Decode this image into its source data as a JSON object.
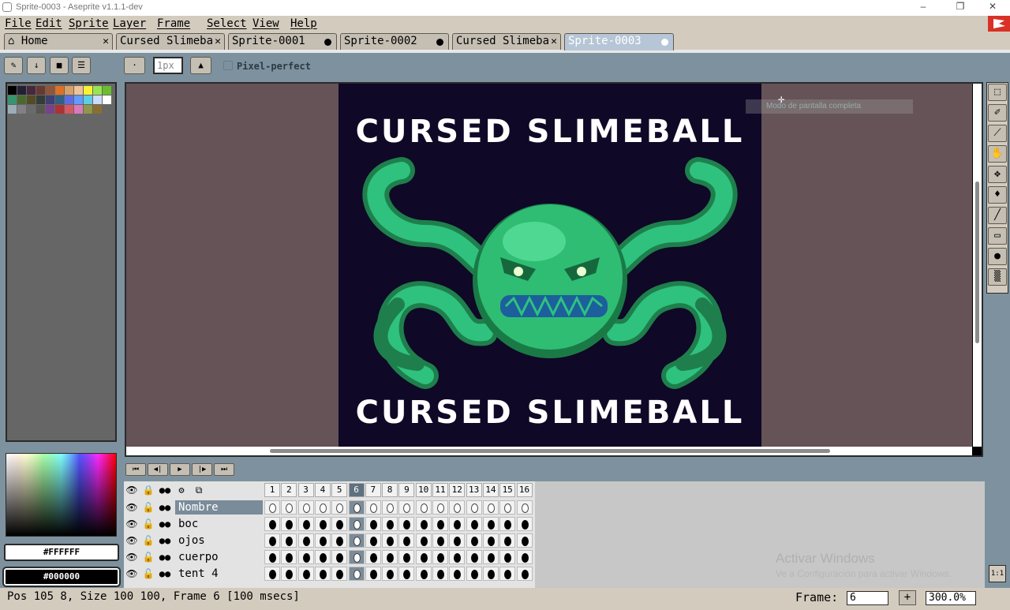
{
  "window": {
    "title": "Sprite-0003 - Aseprite v1.1.1-dev",
    "minimize": "‒",
    "maximize": "❐",
    "close": "✕"
  },
  "menu": [
    "File",
    "Edit",
    "Sprite",
    "Layer",
    "Frame",
    "Select",
    "View",
    "Help"
  ],
  "tabs": [
    {
      "label": "Home",
      "mark": "✕"
    },
    {
      "label": "Cursed Slimeba",
      "mark": "✕"
    },
    {
      "label": "Sprite-0001",
      "mark": ""
    },
    {
      "label": "Sprite-0002",
      "mark": ""
    },
    {
      "label": "Cursed Slimeba",
      "mark": "✕"
    },
    {
      "label": "Sprite-0003",
      "mark": ""
    }
  ],
  "context_bar": {
    "brush_size": "1px",
    "pixel_perfect_label": "Pixel-perfect"
  },
  "palette": {
    "colors": [
      "#000000",
      "#222034",
      "#45283c",
      "#663931",
      "#8f563b",
      "#df7126",
      "#d9a066",
      "#eec39a",
      "#fbf236",
      "#99e550",
      "#6abe30",
      "#37946e",
      "#4b692f",
      "#524b24",
      "#323c39",
      "#3f3f74",
      "#306082",
      "#5b6ee1",
      "#639bff",
      "#5fcde4",
      "#cbdbfc",
      "#ffffff",
      "#9badb7",
      "#847e87",
      "#696a6a",
      "#595652",
      "#76428a",
      "#ac3232",
      "#d95763",
      "#d77bba",
      "#8f974a",
      "#8a6f30"
    ]
  },
  "colors": {
    "foreground": "#FFFFFF",
    "background": "#000000"
  },
  "canvas": {
    "caption_top": "CURSED SLIMEBALL",
    "caption_bottom": "CURSED SLIMEBALL",
    "tooltip": "Modo de pantalla completa"
  },
  "playback": [
    "⏮",
    "◀|",
    "▶",
    "|▶",
    "⏭"
  ],
  "timeline": {
    "frames": [
      "1",
      "2",
      "3",
      "4",
      "5",
      "6",
      "7",
      "8",
      "9",
      "10",
      "11",
      "12",
      "13",
      "14",
      "15",
      "16"
    ],
    "current_frame_index": 5,
    "layers": [
      {
        "name": "Nombre",
        "selected": true
      },
      {
        "name": "boc",
        "selected": false
      },
      {
        "name": "ojos",
        "selected": false
      },
      {
        "name": "cuerpo",
        "selected": false
      },
      {
        "name": "tent 4",
        "selected": false
      }
    ]
  },
  "status": {
    "text": "Pos 105 8, Size 100 100, Frame 6 [100 msecs]",
    "frame_label": "Frame:",
    "frame_value": "6",
    "zoom": "300.0%"
  },
  "watermark": {
    "line1": "Activar Windows",
    "line2": "Ve a Configuración para activar Windows."
  },
  "tools": [
    "selection-tool",
    "eraser-tool",
    "eyedropper-tool",
    "hand-tool",
    "move-tool",
    "paint-bucket-tool",
    "line-tool",
    "rectangle-tool",
    "contour-tool",
    "blur-tool"
  ]
}
